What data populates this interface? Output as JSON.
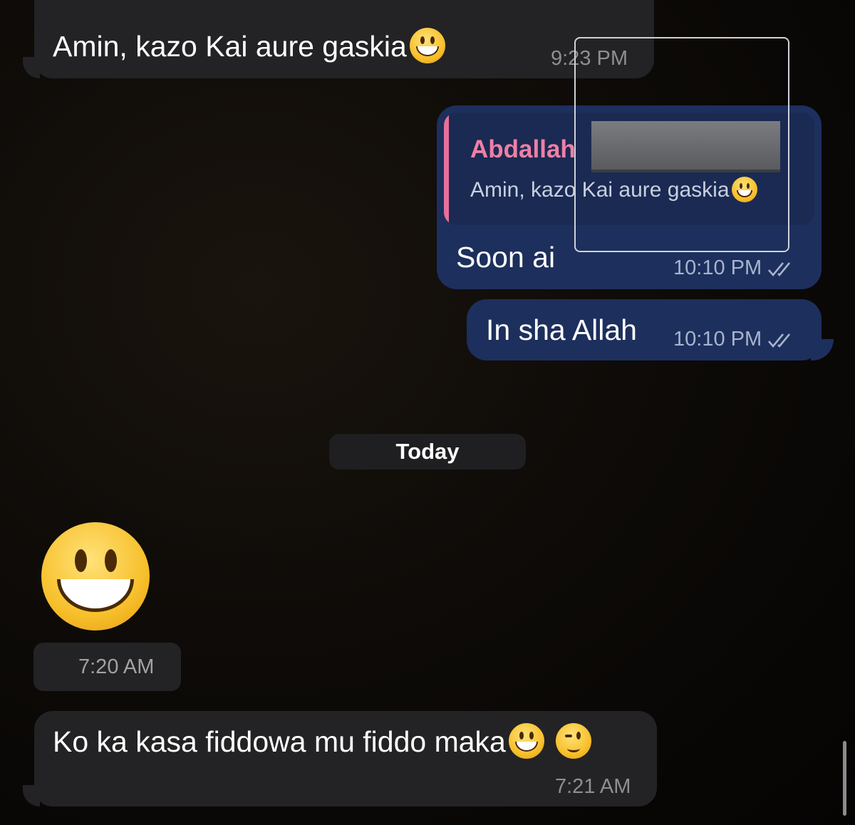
{
  "messages": {
    "m1": {
      "text": "Amin, kazo Kai aure gaskia",
      "emoji": "grinning-face",
      "time": "9:23 PM"
    },
    "m2": {
      "reply": {
        "author": "Abdallah",
        "text": "Amin, kazo Kai aure gaskia",
        "emoji": "grinning-face"
      },
      "text": "Soon ai",
      "time": "10:10 PM",
      "status": "read-double-check-icon"
    },
    "m3": {
      "text": "In sha Allah",
      "time": "10:10 PM",
      "status": "read-double-check-icon"
    },
    "date_separator": "Today",
    "m4": {
      "emoji": "grinning-face",
      "time": "7:20 AM"
    },
    "m5": {
      "text": "Ko ka kasa fiddowa mu fiddo maka",
      "emojis": [
        "grinning-face",
        "winking-face"
      ],
      "time": "7:21 AM"
    }
  },
  "colors": {
    "incoming_bubble": "#232325",
    "outgoing_bubble": "#1d2f5c",
    "reply_accent": "#e8709a",
    "reply_author": "#ef7fa6"
  }
}
